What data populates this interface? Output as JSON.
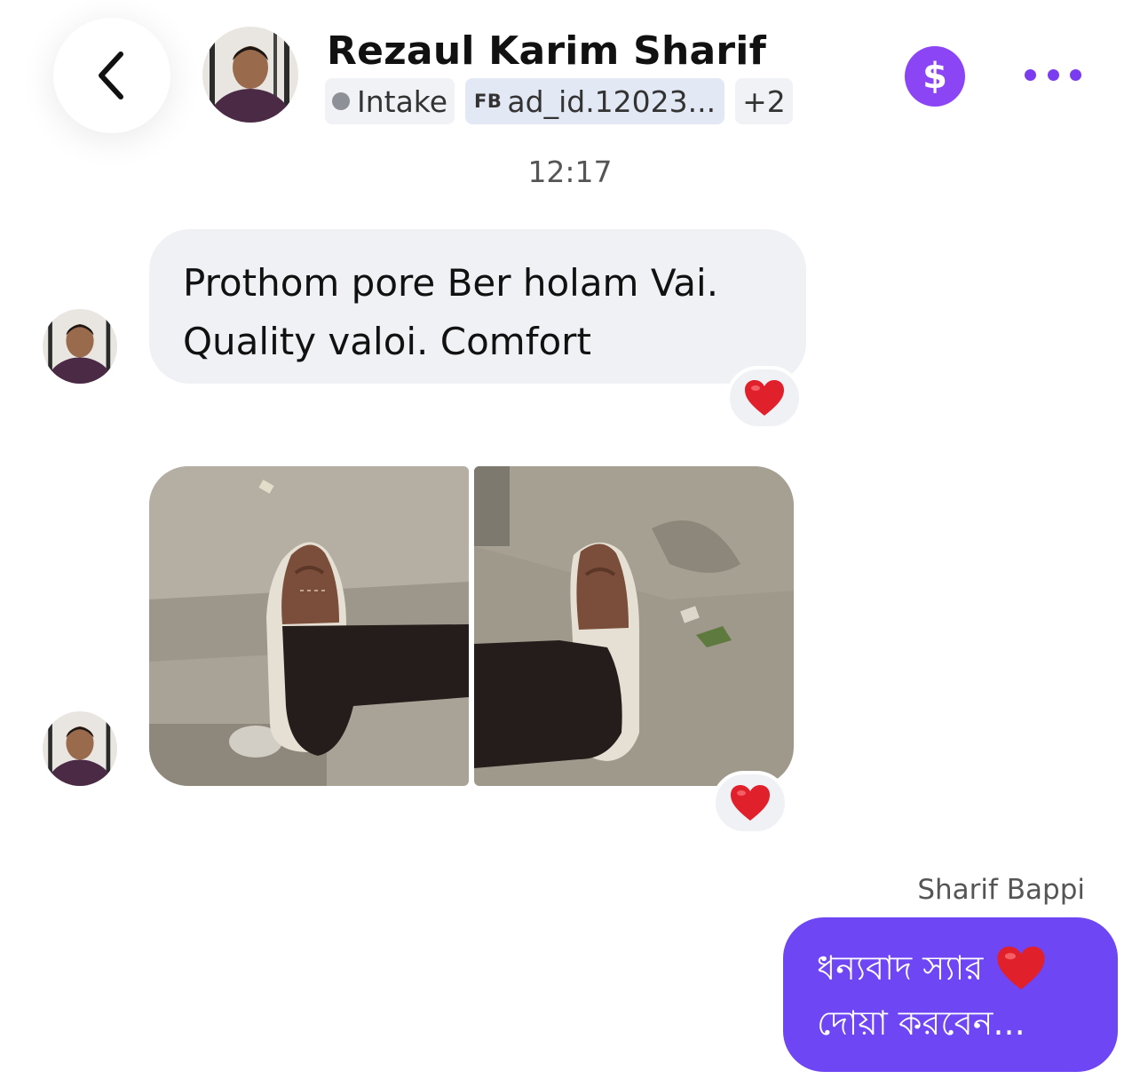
{
  "header": {
    "contact_name": "Rezaul Karim Sharif",
    "tags": [
      {
        "label": "Intake"
      },
      {
        "prefix": "FB",
        "label": "ad_id.12023..."
      },
      {
        "label": "+2"
      }
    ],
    "dollar_symbol": "$"
  },
  "conversation": {
    "timestamp": "12:17",
    "incoming_message": {
      "lines": [
        "Prothom pore Ber holam Vai.",
        "Quality valoi. Comfort"
      ],
      "reaction": "heart"
    },
    "incoming_photos": {
      "count": 2,
      "reaction": "heart"
    },
    "outgoing_message": {
      "sender": "Sharif Bappi",
      "line1": "ধন্যবাদ স্যার",
      "line2": "দোয়া করবেন...",
      "emoji": "heart"
    }
  },
  "colors": {
    "accent_purple": "#8c45f5",
    "outgoing_bubble": "#6e46f3",
    "incoming_bubble": "#f0f1f5",
    "heart": "#e0202b"
  },
  "icons": [
    "back-chevron-icon",
    "dollar-icon",
    "more-options-icon",
    "heart-icon"
  ]
}
